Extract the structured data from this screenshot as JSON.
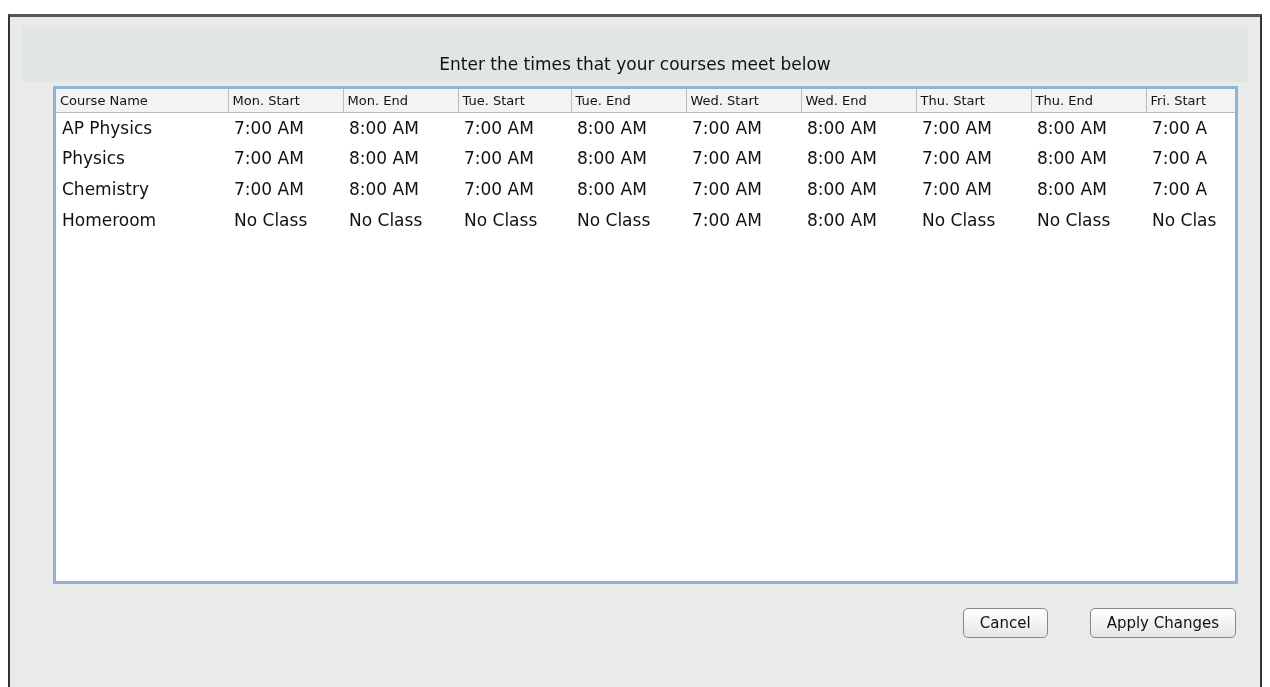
{
  "dialog": {
    "title": "Enter the times that your courses meet below"
  },
  "table": {
    "columns": [
      "Course Name",
      "Mon. Start",
      "Mon. End",
      "Tue. Start",
      "Tue. End",
      "Wed. Start",
      "Wed. End",
      "Thu. Start",
      "Thu. End",
      "Fri. Start"
    ],
    "rows": [
      [
        "AP Physics",
        "7:00 AM",
        "8:00 AM",
        "7:00 AM",
        "8:00 AM",
        "7:00 AM",
        "8:00 AM",
        "7:00 AM",
        "8:00 AM",
        "7:00 A"
      ],
      [
        "Physics",
        "7:00 AM",
        "8:00 AM",
        "7:00 AM",
        "8:00 AM",
        "7:00 AM",
        "8:00 AM",
        "7:00 AM",
        "8:00 AM",
        "7:00 A"
      ],
      [
        "Chemistry",
        "7:00 AM",
        "8:00 AM",
        "7:00 AM",
        "8:00 AM",
        "7:00 AM",
        "8:00 AM",
        "7:00 AM",
        "8:00 AM",
        "7:00 A"
      ],
      [
        "Homeroom",
        "No Class",
        "No Class",
        "No Class",
        "No Class",
        "7:00 AM",
        "8:00 AM",
        "No Class",
        "No Class",
        "No Clas"
      ]
    ]
  },
  "buttons": [
    "Cancel",
    "Apply Changes"
  ]
}
